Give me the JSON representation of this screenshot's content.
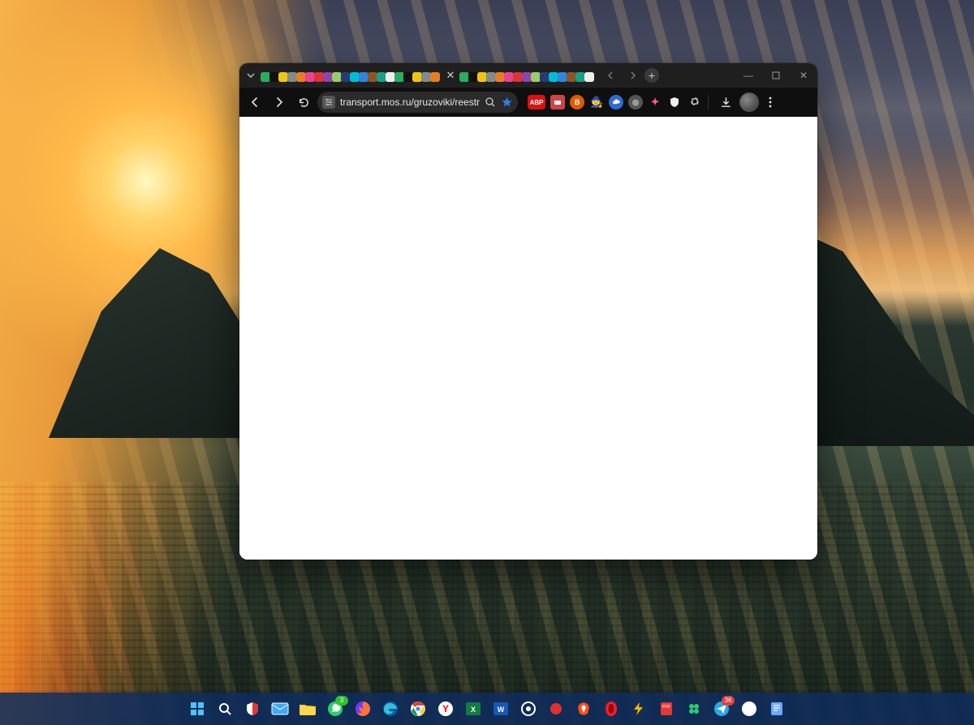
{
  "browser": {
    "tab_groups": {
      "left_count": 20,
      "right_count": 15
    },
    "nav": {
      "back_enabled": true,
      "forward_enabled": true
    },
    "omnibox": {
      "site_settings_label": "⇆",
      "url": "transport.mos.ru/gruzoviki/reestr",
      "bookmarked": true
    },
    "extensions": [
      {
        "name": "abp",
        "label": "ABP",
        "bg": "#d11",
        "fg": "#fff",
        "shape": "pill"
      },
      {
        "name": "wallet",
        "label": "",
        "bg": "#c44",
        "fg": "#fff",
        "shape": "square"
      },
      {
        "name": "b-ext",
        "label": "B",
        "bg": "#e05a00",
        "fg": "#fff",
        "shape": "circle"
      },
      {
        "name": "pirate",
        "label": "",
        "bg": "none",
        "fg": "#c98b4a",
        "shape": "glyph",
        "glyph": "🧙"
      },
      {
        "name": "cloud",
        "label": "",
        "bg": "#2e6bd6",
        "fg": "#fff",
        "shape": "cloud"
      },
      {
        "name": "grey-ext",
        "label": "◎",
        "bg": "#555",
        "fg": "#ddd",
        "shape": "circle"
      },
      {
        "name": "color-ext",
        "label": "✦",
        "bg": "none",
        "fg": "#ff5aa0",
        "shape": "glyph"
      },
      {
        "name": "shield",
        "label": "",
        "bg": "none",
        "fg": "#eee",
        "shape": "shield"
      },
      {
        "name": "puzzle",
        "label": "",
        "bg": "none",
        "fg": "#ddd",
        "shape": "puzzle"
      }
    ],
    "window_controls": {
      "minimize": "—",
      "maximize": "□",
      "close": "✕"
    },
    "menu_tooltip": "⋮"
  },
  "taskbar": {
    "icons": [
      {
        "name": "start",
        "glyph": "win",
        "color": "#4cc2ff"
      },
      {
        "name": "search",
        "glyph": "search",
        "color": "#ffffff"
      },
      {
        "name": "guard",
        "glyph": "shield-g",
        "color": "#e53935"
      },
      {
        "name": "mail",
        "glyph": "mail",
        "color": "#4aa3ff"
      },
      {
        "name": "explorer",
        "glyph": "folder",
        "color": "#ffd54a"
      },
      {
        "name": "whatsapp",
        "glyph": "whatsapp",
        "color": "#25d366",
        "badge": "3"
      },
      {
        "name": "firefox",
        "glyph": "firefox",
        "color": "#ff7139"
      },
      {
        "name": "edge",
        "glyph": "edge",
        "color": "#33c1d4"
      },
      {
        "name": "chrome",
        "glyph": "chrome",
        "color": "#ffffff"
      },
      {
        "name": "yandex",
        "glyph": "Y",
        "color": "#ffffff"
      },
      {
        "name": "excel",
        "glyph": "xl",
        "color": "#107c41"
      },
      {
        "name": "word",
        "glyph": "wd",
        "color": "#1857b6"
      },
      {
        "name": "record",
        "glyph": "disc",
        "color": "#ffffff"
      },
      {
        "name": "rec-app",
        "glyph": "dot",
        "color": "#e03030"
      },
      {
        "name": "brave",
        "glyph": "brave",
        "color": "#ff4f12"
      },
      {
        "name": "opera",
        "glyph": "O",
        "color": "#ff1b2d"
      },
      {
        "name": "bolt",
        "glyph": "bolt",
        "color": "#ffb300"
      },
      {
        "name": "pdf",
        "glyph": "pdf",
        "color": "#e53935"
      },
      {
        "name": "green-app",
        "glyph": "clover",
        "color": "#2ecc71"
      },
      {
        "name": "telegram",
        "glyph": "plane",
        "color": "#29a9ea",
        "badge": "36",
        "badgeColor": "red"
      },
      {
        "name": "whatsapp2",
        "glyph": "whatsapp",
        "color": "#ffffff"
      },
      {
        "name": "notes",
        "glyph": "note",
        "color": "#6ea8ff"
      }
    ]
  }
}
